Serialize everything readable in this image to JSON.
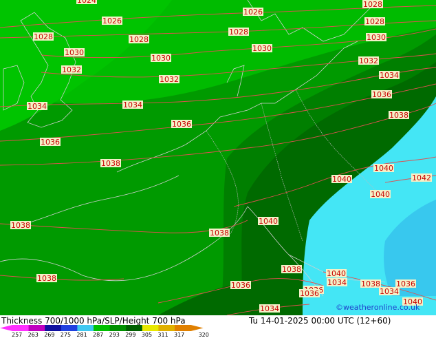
{
  "map": {
    "credit": "©weatheronline.co.uk",
    "fill_colors": {
      "band_281": "#00c000",
      "band_287": "#00a000",
      "band_293": "#008000",
      "band_299": "#006600",
      "band_305": "#44e6f5",
      "band_311": "#3fd0f0",
      "coast": "#c8c8c8",
      "isobar": "#e05050",
      "label_bg": "#f4f1c8",
      "label_text": "#c80000"
    },
    "isobar_labels": [
      "1024",
      "1026",
      "1026",
      "1028",
      "1028",
      "1028",
      "1028",
      "1028",
      "1030",
      "1030",
      "1030",
      "1030",
      "1032",
      "1032",
      "1032",
      "1034",
      "1034",
      "1034",
      "1036",
      "1036",
      "1036",
      "1038",
      "1038",
      "1038",
      "1038",
      "1038",
      "1040",
      "1040",
      "1040",
      "1042",
      "1040",
      "1038",
      "1040",
      "1034",
      "1036",
      "1036",
      "1038",
      "1036",
      "1034",
      "1034",
      "1040",
      "1036"
    ]
  },
  "footer": {
    "title": "Thickness 700/1000 hPa/SLP/Height 700 hPa",
    "datetime": "Tu 14-01-2025 00:00 UTC (12+60)",
    "scale_ticks": [
      "257",
      "263",
      "269",
      "275",
      "281",
      "287",
      "293",
      "299",
      "305",
      "311",
      "317",
      "320"
    ],
    "scale_colors": [
      "#ff30ff",
      "#c000c0",
      "#1010a0",
      "#2040e0",
      "#40c8f0",
      "#00c000",
      "#009000",
      "#006000",
      "#e8e800",
      "#e0b000",
      "#e08000",
      "#e08000"
    ]
  }
}
